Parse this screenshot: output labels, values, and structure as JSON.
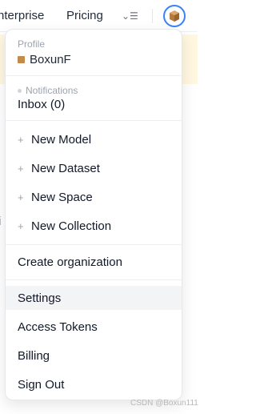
{
  "nav": {
    "enterprise": "nterprise",
    "pricing": "Pricing",
    "more_icon": "⌄☰"
  },
  "background": {
    "fragment": "i"
  },
  "dropdown": {
    "profile_label": "Profile",
    "username": "BoxunF",
    "notifications_label": "Notifications",
    "inbox": "Inbox (0)",
    "new_items": [
      {
        "plus": "+",
        "label": "New Model"
      },
      {
        "plus": "+",
        "label": "New Dataset"
      },
      {
        "plus": "+",
        "label": "New Space"
      },
      {
        "plus": "+",
        "label": "New Collection"
      }
    ],
    "create_org": "Create organization",
    "settings": "Settings",
    "access_tokens": "Access Tokens",
    "billing": "Billing",
    "sign_out": "Sign Out"
  },
  "watermark": "CSDN @Boxun111",
  "colors": {
    "accent": "#3b82f6",
    "banner": "#fff7e0",
    "hover_bg": "#f3f4f6"
  }
}
